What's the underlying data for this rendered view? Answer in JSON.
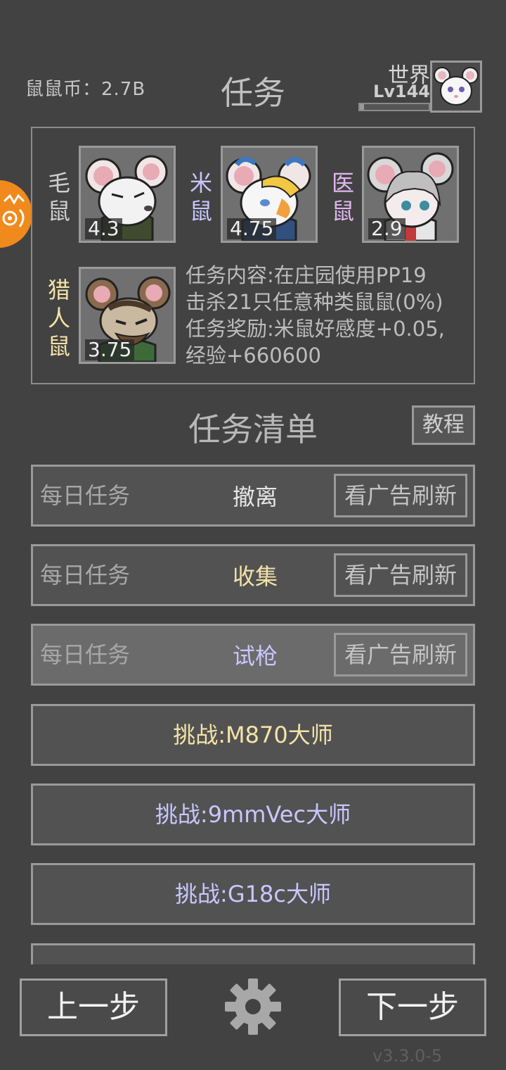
{
  "header": {
    "coin_label": "鼠鼠币：2.7B",
    "title": "任务",
    "world_label": "世界",
    "level": "Lv144",
    "level_progress": 0.06
  },
  "characters": [
    {
      "name": "毛鼠",
      "rating": "4.3",
      "name_color": "#cfcfcf"
    },
    {
      "name": "米鼠",
      "rating": "4.75",
      "name_color": "#c9c6ff"
    },
    {
      "name": "医鼠",
      "rating": "2.9",
      "name_color": "#e0b7f0"
    },
    {
      "name": "猎人鼠",
      "rating": "3.75",
      "name_color": "#f4e3a8"
    }
  ],
  "task": {
    "line1": "任务内容:在庄园使用PP19",
    "line2": "击杀21只任意种类鼠鼠(0%)",
    "line3": "任务奖励:米鼠好感度+0.05,",
    "line4": "经验+660600"
  },
  "list": {
    "title": "任务清单",
    "tutorial_button": "教程",
    "daily_rows": [
      {
        "daily_label": "每日任务",
        "type": "撤离",
        "type_color": "#e6e6e6",
        "refresh": "看广告刷新"
      },
      {
        "daily_label": "每日任务",
        "type": "收集",
        "type_color": "#f4e3a8",
        "refresh": "看广告刷新"
      },
      {
        "daily_label": "每日任务",
        "type": "试枪",
        "type_color": "#c9c6ff",
        "refresh": "看广告刷新"
      }
    ],
    "challenges": [
      {
        "label": "挑战:M870大师",
        "color": "#f4e3a8"
      },
      {
        "label": "挑战:9mmVec大师",
        "color": "#c9c6ff"
      },
      {
        "label": "挑战:G18c大师",
        "color": "#c9c6ff"
      }
    ]
  },
  "footer": {
    "prev": "上一步",
    "next": "下一步",
    "version": "v3.3.0-5"
  }
}
